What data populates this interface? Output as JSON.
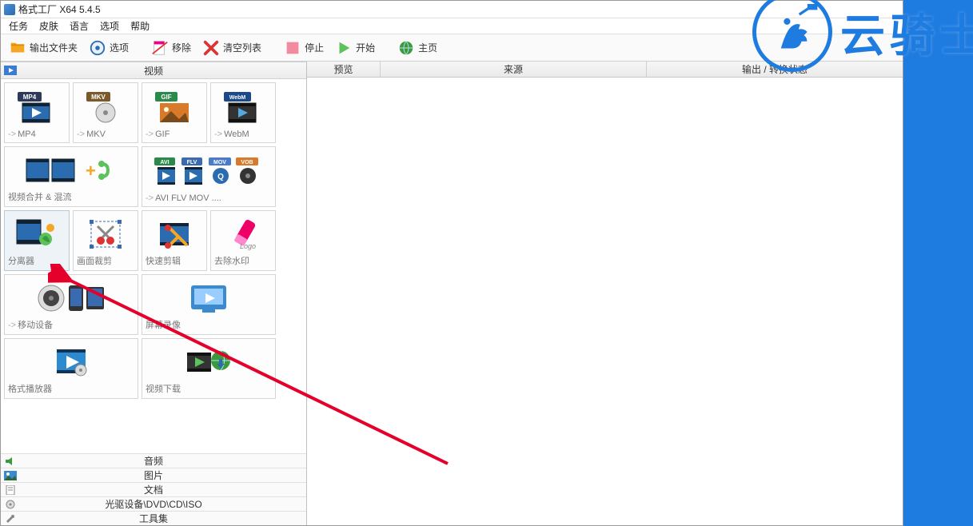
{
  "window": {
    "title": "格式工厂 X64 5.4.5"
  },
  "menu": {
    "task": "任务",
    "skin": "皮肤",
    "language": "语言",
    "options": "选项",
    "help": "帮助"
  },
  "toolbar": {
    "output_folder": "输出文件夹",
    "options": "选项",
    "remove": "移除",
    "clear_list": "清空列表",
    "stop": "停止",
    "start": "开始",
    "homepage": "主页"
  },
  "sections": {
    "video": "视频"
  },
  "tiles": {
    "mp4": "MP4",
    "mkv": "MKV",
    "gif": "GIF",
    "webm": "WebM",
    "merge": "视频合并 & 混流",
    "avi_etc": "AVI FLV MOV ....",
    "splitter": "分离器",
    "crop": "画面裁剪",
    "quick_trim": "快速剪辑",
    "remove_wm": "去除水印",
    "mobile": "移动设备",
    "screen_rec": "屏幕录像",
    "player": "格式播放器",
    "video_dl": "视频下载"
  },
  "categories": {
    "audio": "音频",
    "image": "图片",
    "document": "文档",
    "optical": "光驱设备\\DVD\\CD\\ISO",
    "toolset": "工具集"
  },
  "list_columns": {
    "preview": "预览",
    "source": "来源",
    "output_status": "输出 / 转换状态"
  },
  "watermark": {
    "text": "云骑士"
  },
  "arrow_symbol": "->"
}
